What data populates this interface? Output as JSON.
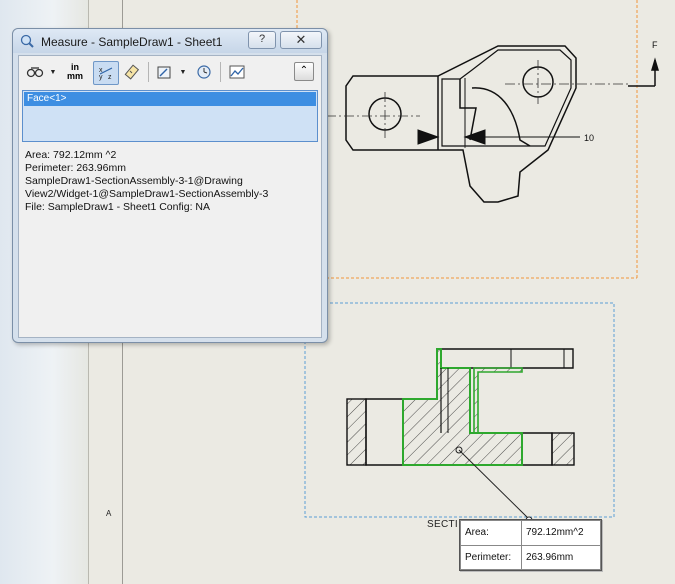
{
  "dialog": {
    "title": "Measure - SampleDraw1 - Sheet1",
    "help_label": "?",
    "close_label": "✕",
    "toolbar": {
      "units_top": "in",
      "units_bottom": "mm",
      "collapse_label": "⌃"
    },
    "selection": [
      "Face<1>"
    ],
    "results": [
      "Area: 792.12mm ^2",
      "Perimeter: 263.96mm",
      "SampleDraw1-SectionAssembly-3-1@Drawing",
      "View2/Widget-1@SampleDraw1-SectionAssembly-3",
      "File: SampleDraw1 - Sheet1 Config: NA"
    ]
  },
  "drawing": {
    "section_label": "SECTI",
    "arrow_label": "F",
    "dimension_label": "10",
    "zone_letter": "A"
  },
  "callout": {
    "rows": [
      {
        "label": "Area:",
        "value": "792.12mm^2"
      },
      {
        "label": "Perimeter:",
        "value": "263.96mm"
      }
    ]
  },
  "colors": {
    "highlight_green": "#2ea82e",
    "dashed_orange": "#f0953b",
    "dashed_blue": "#5b9fd6",
    "selection_blue": "#3d8ee2"
  }
}
